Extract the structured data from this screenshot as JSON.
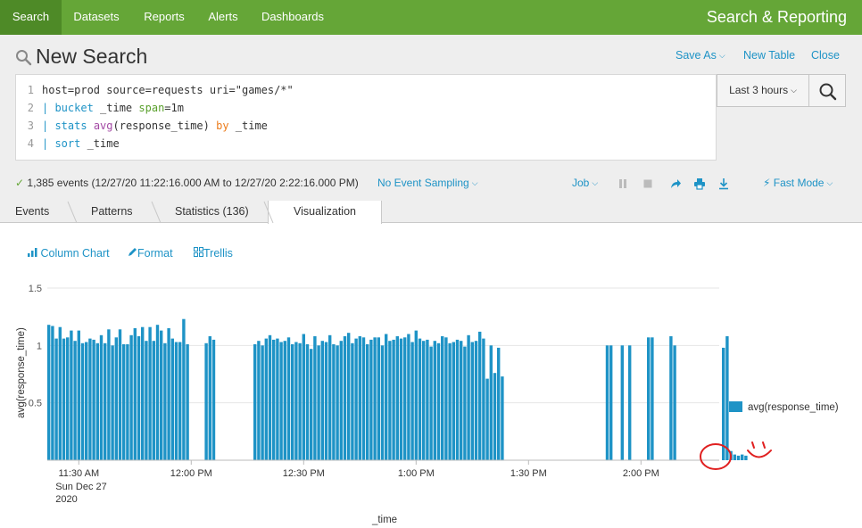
{
  "nav": {
    "tabs": [
      "Search",
      "Datasets",
      "Reports",
      "Alerts",
      "Dashboards"
    ],
    "app_title": "Search & Reporting"
  },
  "header": {
    "title": "New Search",
    "save_as": "Save As",
    "new_table": "New Table",
    "close": "Close"
  },
  "query": {
    "line_numbers": [
      "1",
      "2",
      "3",
      "4"
    ],
    "l1": "host=prod source=requests uri=\"games/*\"",
    "l2_pipe": "| ",
    "l2_cmd": "bucket",
    "l2_field": " _time ",
    "l2_arg": "span",
    "l2_val": "=1m",
    "l3_pipe": "| ",
    "l3_cmd": "stats",
    "l3_space": " ",
    "l3_func": "avg",
    "l3_args": "(response_time) ",
    "l3_by": "by",
    "l3_rest": " _time",
    "l4_pipe": "| ",
    "l4_cmd": "sort",
    "l4_rest": " _time"
  },
  "time_picker": {
    "label": "Last 3 hours"
  },
  "status": {
    "events": "1,385 events (12/27/20 11:22:16.000 AM to 12/27/20 2:22:16.000 PM)",
    "sampling": "No Event Sampling",
    "job": "Job",
    "mode": "Fast Mode"
  },
  "tabs": [
    "Events",
    "Patterns",
    "Statistics (136)",
    "Visualization"
  ],
  "viz_toolbar": {
    "chart_type": "Column Chart",
    "format": "Format",
    "trellis": "Trellis"
  },
  "colors": {
    "nav": "#65a637",
    "accent": "#1e93c6",
    "bar": "#1e93c6",
    "annotation": "#e02020"
  },
  "chart_data": {
    "type": "bar",
    "x_start": "11:22 AM",
    "x_interval": "1m",
    "values": [
      1.18,
      1.17,
      1.06,
      1.16,
      1.06,
      1.07,
      1.13,
      1.04,
      1.13,
      1.02,
      1.03,
      1.06,
      1.05,
      1.02,
      1.09,
      1.02,
      1.14,
      1.0,
      1.07,
      1.14,
      1.01,
      1.01,
      1.09,
      1.15,
      1.08,
      1.16,
      1.04,
      1.16,
      1.04,
      1.18,
      1.13,
      1.02,
      1.15,
      1.06,
      1.03,
      1.03,
      1.23,
      1.01,
      null,
      null,
      null,
      null,
      1.02,
      1.08,
      1.05,
      null,
      null,
      null,
      null,
      null,
      null,
      null,
      null,
      null,
      null,
      1.01,
      1.04,
      1.0,
      1.06,
      1.09,
      1.05,
      1.06,
      1.03,
      1.04,
      1.07,
      1.01,
      1.03,
      1.02,
      1.1,
      1.01,
      0.97,
      1.08,
      1.0,
      1.04,
      1.03,
      1.09,
      1.01,
      1.0,
      1.04,
      1.08,
      1.11,
      1.02,
      1.06,
      1.08,
      1.07,
      1.01,
      1.05,
      1.07,
      1.07,
      1.0,
      1.1,
      1.04,
      1.05,
      1.08,
      1.06,
      1.07,
      1.1,
      1.03,
      1.13,
      1.06,
      1.04,
      1.05,
      0.99,
      1.04,
      1.02,
      1.08,
      1.07,
      1.02,
      1.03,
      1.05,
      1.04,
      0.99,
      1.09,
      1.03,
      1.04,
      1.12,
      1.06,
      0.71,
      1.0,
      0.76,
      0.98,
      0.73,
      null,
      null,
      null,
      null,
      null,
      null,
      null,
      null,
      null,
      null,
      null,
      null,
      null,
      null,
      null,
      null,
      null,
      null,
      null,
      null,
      null,
      null,
      null,
      null,
      null,
      null,
      null,
      1.0,
      1.0,
      null,
      null,
      1.0,
      null,
      1.0,
      null,
      null,
      null,
      null,
      1.07,
      1.07,
      null,
      null,
      null,
      null,
      1.08,
      1.0,
      null,
      null,
      null,
      null,
      null,
      null,
      null,
      null,
      null,
      null,
      null,
      null,
      0.98,
      1.08,
      0.08,
      0.05,
      0.04,
      0.05,
      0.04
    ],
    "ylabel": "avg(response_time)",
    "xlabel": "_time",
    "ylim": [
      0,
      1.5
    ],
    "y_ticks": [
      "1.5",
      "1",
      "0.5"
    ],
    "x_ticks": [
      "11:30 AM",
      "12:00 PM",
      "12:30 PM",
      "1:00 PM",
      "1:30 PM",
      "2:00 PM"
    ],
    "x_subticks": [
      "Sun Dec 27",
      "2020"
    ],
    "legend": [
      "avg(response_time)"
    ],
    "grid": true,
    "legend_position": "right"
  }
}
